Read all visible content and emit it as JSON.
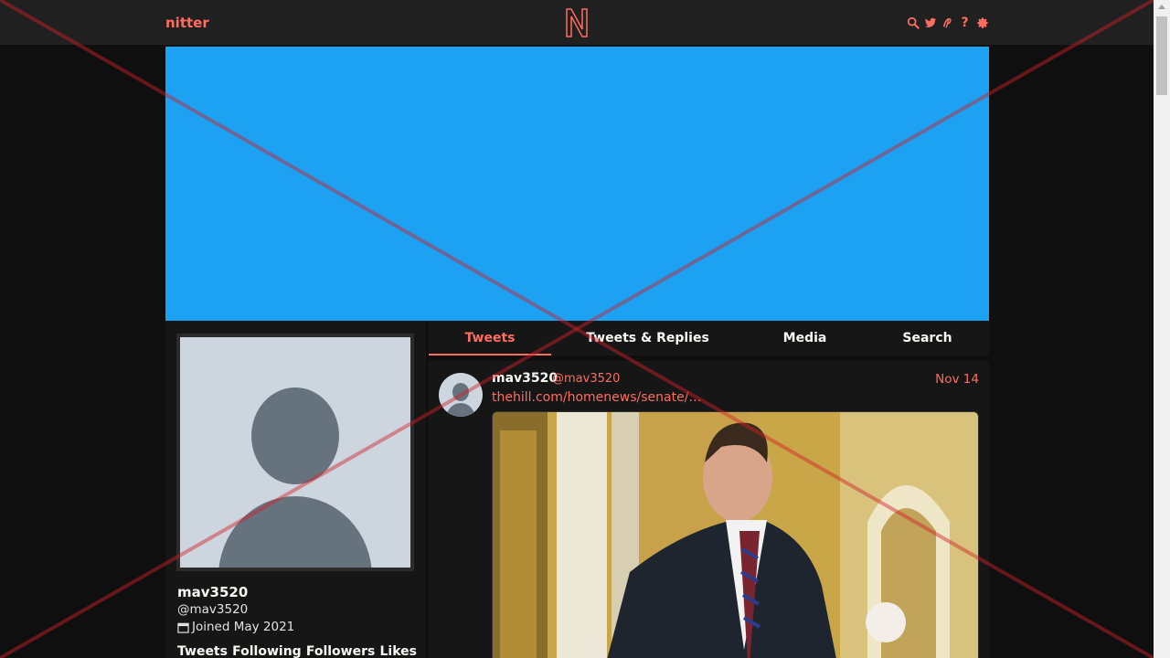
{
  "nav": {
    "brand": "nitter",
    "logo_letter": "N",
    "icons": [
      "search-icon",
      "twitter-icon",
      "rss-icon",
      "help-icon",
      "gear-icon"
    ],
    "help_glyph": "?"
  },
  "colors": {
    "accent": "#ff6c60",
    "banner": "#1da1f2",
    "background": "#0f0f0f",
    "panel": "#161616"
  },
  "profile": {
    "name": "mav3520",
    "handle": "@mav3520",
    "joined": "Joined May 2021",
    "stats": [
      "Tweets",
      "Following",
      "Followers",
      "Likes"
    ]
  },
  "tabs": [
    {
      "label": "Tweets",
      "active": true
    },
    {
      "label": "Tweets & Replies",
      "active": false
    },
    {
      "label": "Media",
      "active": false
    },
    {
      "label": "Search",
      "active": false
    }
  ],
  "tweet": {
    "name": "mav3520",
    "handle": "@mav3520",
    "date": "Nov 14",
    "link": "thehill.com/homenews/senate/…"
  }
}
